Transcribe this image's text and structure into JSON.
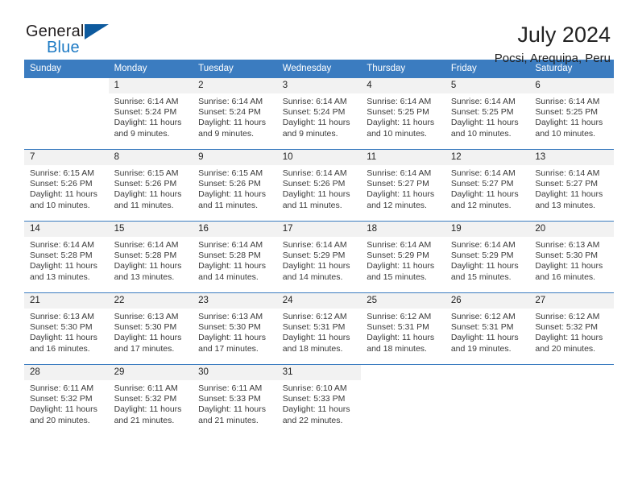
{
  "brand": {
    "word_one": "General",
    "word_two": "Blue",
    "triangle_color": "#0d5a9e",
    "blue_color": "#1d7ac4"
  },
  "header": {
    "title": "July 2024",
    "location": "Pocsi, Arequipa, Peru"
  },
  "theme": {
    "header_blue": "#3b7cc0",
    "daynum_background": "#f2f2f2"
  },
  "weekday_headers": [
    "Sunday",
    "Monday",
    "Tuesday",
    "Wednesday",
    "Thursday",
    "Friday",
    "Saturday"
  ],
  "weeks": [
    [
      {
        "day": "",
        "sunrise": "",
        "sunset": "",
        "daylight": "",
        "daylight2": ""
      },
      {
        "day": "1",
        "sunrise": "Sunrise: 6:14 AM",
        "sunset": "Sunset: 5:24 PM",
        "daylight": "Daylight: 11 hours",
        "daylight2": "and 9 minutes."
      },
      {
        "day": "2",
        "sunrise": "Sunrise: 6:14 AM",
        "sunset": "Sunset: 5:24 PM",
        "daylight": "Daylight: 11 hours",
        "daylight2": "and 9 minutes."
      },
      {
        "day": "3",
        "sunrise": "Sunrise: 6:14 AM",
        "sunset": "Sunset: 5:24 PM",
        "daylight": "Daylight: 11 hours",
        "daylight2": "and 9 minutes."
      },
      {
        "day": "4",
        "sunrise": "Sunrise: 6:14 AM",
        "sunset": "Sunset: 5:25 PM",
        "daylight": "Daylight: 11 hours",
        "daylight2": "and 10 minutes."
      },
      {
        "day": "5",
        "sunrise": "Sunrise: 6:14 AM",
        "sunset": "Sunset: 5:25 PM",
        "daylight": "Daylight: 11 hours",
        "daylight2": "and 10 minutes."
      },
      {
        "day": "6",
        "sunrise": "Sunrise: 6:14 AM",
        "sunset": "Sunset: 5:25 PM",
        "daylight": "Daylight: 11 hours",
        "daylight2": "and 10 minutes."
      }
    ],
    [
      {
        "day": "7",
        "sunrise": "Sunrise: 6:15 AM",
        "sunset": "Sunset: 5:26 PM",
        "daylight": "Daylight: 11 hours",
        "daylight2": "and 10 minutes."
      },
      {
        "day": "8",
        "sunrise": "Sunrise: 6:15 AM",
        "sunset": "Sunset: 5:26 PM",
        "daylight": "Daylight: 11 hours",
        "daylight2": "and 11 minutes."
      },
      {
        "day": "9",
        "sunrise": "Sunrise: 6:15 AM",
        "sunset": "Sunset: 5:26 PM",
        "daylight": "Daylight: 11 hours",
        "daylight2": "and 11 minutes."
      },
      {
        "day": "10",
        "sunrise": "Sunrise: 6:14 AM",
        "sunset": "Sunset: 5:26 PM",
        "daylight": "Daylight: 11 hours",
        "daylight2": "and 11 minutes."
      },
      {
        "day": "11",
        "sunrise": "Sunrise: 6:14 AM",
        "sunset": "Sunset: 5:27 PM",
        "daylight": "Daylight: 11 hours",
        "daylight2": "and 12 minutes."
      },
      {
        "day": "12",
        "sunrise": "Sunrise: 6:14 AM",
        "sunset": "Sunset: 5:27 PM",
        "daylight": "Daylight: 11 hours",
        "daylight2": "and 12 minutes."
      },
      {
        "day": "13",
        "sunrise": "Sunrise: 6:14 AM",
        "sunset": "Sunset: 5:27 PM",
        "daylight": "Daylight: 11 hours",
        "daylight2": "and 13 minutes."
      }
    ],
    [
      {
        "day": "14",
        "sunrise": "Sunrise: 6:14 AM",
        "sunset": "Sunset: 5:28 PM",
        "daylight": "Daylight: 11 hours",
        "daylight2": "and 13 minutes."
      },
      {
        "day": "15",
        "sunrise": "Sunrise: 6:14 AM",
        "sunset": "Sunset: 5:28 PM",
        "daylight": "Daylight: 11 hours",
        "daylight2": "and 13 minutes."
      },
      {
        "day": "16",
        "sunrise": "Sunrise: 6:14 AM",
        "sunset": "Sunset: 5:28 PM",
        "daylight": "Daylight: 11 hours",
        "daylight2": "and 14 minutes."
      },
      {
        "day": "17",
        "sunrise": "Sunrise: 6:14 AM",
        "sunset": "Sunset: 5:29 PM",
        "daylight": "Daylight: 11 hours",
        "daylight2": "and 14 minutes."
      },
      {
        "day": "18",
        "sunrise": "Sunrise: 6:14 AM",
        "sunset": "Sunset: 5:29 PM",
        "daylight": "Daylight: 11 hours",
        "daylight2": "and 15 minutes."
      },
      {
        "day": "19",
        "sunrise": "Sunrise: 6:14 AM",
        "sunset": "Sunset: 5:29 PM",
        "daylight": "Daylight: 11 hours",
        "daylight2": "and 15 minutes."
      },
      {
        "day": "20",
        "sunrise": "Sunrise: 6:13 AM",
        "sunset": "Sunset: 5:30 PM",
        "daylight": "Daylight: 11 hours",
        "daylight2": "and 16 minutes."
      }
    ],
    [
      {
        "day": "21",
        "sunrise": "Sunrise: 6:13 AM",
        "sunset": "Sunset: 5:30 PM",
        "daylight": "Daylight: 11 hours",
        "daylight2": "and 16 minutes."
      },
      {
        "day": "22",
        "sunrise": "Sunrise: 6:13 AM",
        "sunset": "Sunset: 5:30 PM",
        "daylight": "Daylight: 11 hours",
        "daylight2": "and 17 minutes."
      },
      {
        "day": "23",
        "sunrise": "Sunrise: 6:13 AM",
        "sunset": "Sunset: 5:30 PM",
        "daylight": "Daylight: 11 hours",
        "daylight2": "and 17 minutes."
      },
      {
        "day": "24",
        "sunrise": "Sunrise: 6:12 AM",
        "sunset": "Sunset: 5:31 PM",
        "daylight": "Daylight: 11 hours",
        "daylight2": "and 18 minutes."
      },
      {
        "day": "25",
        "sunrise": "Sunrise: 6:12 AM",
        "sunset": "Sunset: 5:31 PM",
        "daylight": "Daylight: 11 hours",
        "daylight2": "and 18 minutes."
      },
      {
        "day": "26",
        "sunrise": "Sunrise: 6:12 AM",
        "sunset": "Sunset: 5:31 PM",
        "daylight": "Daylight: 11 hours",
        "daylight2": "and 19 minutes."
      },
      {
        "day": "27",
        "sunrise": "Sunrise: 6:12 AM",
        "sunset": "Sunset: 5:32 PM",
        "daylight": "Daylight: 11 hours",
        "daylight2": "and 20 minutes."
      }
    ],
    [
      {
        "day": "28",
        "sunrise": "Sunrise: 6:11 AM",
        "sunset": "Sunset: 5:32 PM",
        "daylight": "Daylight: 11 hours",
        "daylight2": "and 20 minutes."
      },
      {
        "day": "29",
        "sunrise": "Sunrise: 6:11 AM",
        "sunset": "Sunset: 5:32 PM",
        "daylight": "Daylight: 11 hours",
        "daylight2": "and 21 minutes."
      },
      {
        "day": "30",
        "sunrise": "Sunrise: 6:11 AM",
        "sunset": "Sunset: 5:33 PM",
        "daylight": "Daylight: 11 hours",
        "daylight2": "and 21 minutes."
      },
      {
        "day": "31",
        "sunrise": "Sunrise: 6:10 AM",
        "sunset": "Sunset: 5:33 PM",
        "daylight": "Daylight: 11 hours",
        "daylight2": "and 22 minutes."
      },
      {
        "day": "",
        "sunrise": "",
        "sunset": "",
        "daylight": "",
        "daylight2": ""
      },
      {
        "day": "",
        "sunrise": "",
        "sunset": "",
        "daylight": "",
        "daylight2": ""
      },
      {
        "day": "",
        "sunrise": "",
        "sunset": "",
        "daylight": "",
        "daylight2": ""
      }
    ]
  ]
}
